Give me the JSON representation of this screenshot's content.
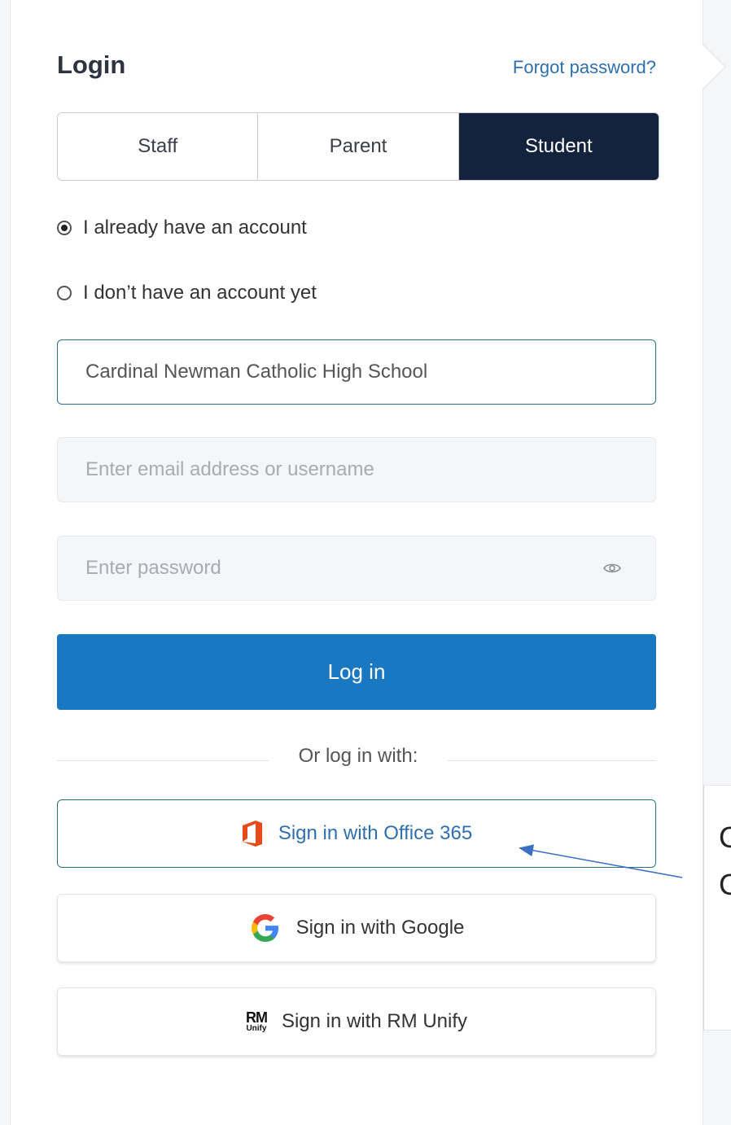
{
  "login": {
    "title": "Login",
    "forgot_password": "Forgot password?"
  },
  "tabs": [
    {
      "label": "Staff",
      "active": false
    },
    {
      "label": "Parent",
      "active": false
    },
    {
      "label": "Student",
      "active": true
    }
  ],
  "account_options": [
    {
      "label": "I already have an account",
      "checked": true
    },
    {
      "label": "I don’t have an account yet",
      "checked": false
    }
  ],
  "school_field": {
    "value": "Cardinal Newman Catholic High School"
  },
  "email_field": {
    "placeholder": "Enter email address or username"
  },
  "password_field": {
    "placeholder": "Enter password"
  },
  "login_button": {
    "label": "Log in"
  },
  "divider": {
    "label": "Or log in with:"
  },
  "sso": {
    "office365": {
      "label": "Sign in with Office 365",
      "icon": "office365-icon"
    },
    "google": {
      "label": "Sign in with Google",
      "icon": "google-icon"
    },
    "rm_unify": {
      "label": "Sign in with RM Unify",
      "icon": "rm-unify-icon",
      "logo_top": "RM",
      "logo_bottom": "Unify"
    }
  },
  "annotation": {
    "fragment_1": "C",
    "fragment_2": "C"
  },
  "colors": {
    "active_tab": "#13223d",
    "primary_button": "#1a78c2",
    "link": "#2f6fb0",
    "focus_border": "#2b6f8a"
  }
}
